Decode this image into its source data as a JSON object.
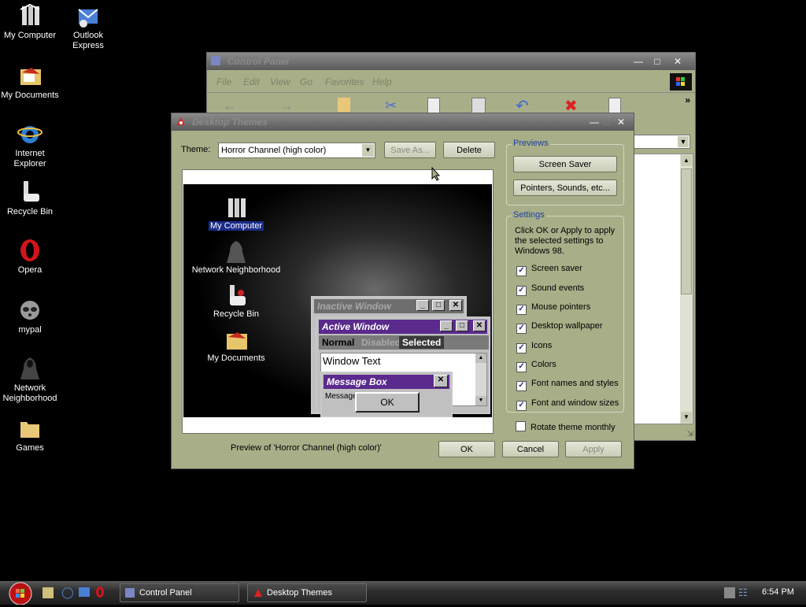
{
  "desktop": {
    "icons": [
      {
        "label": "My Computer",
        "icon": "computer-icon"
      },
      {
        "label": "Outlook Express",
        "icon": "outlook-icon"
      },
      {
        "label": "My Documents",
        "icon": "documents-icon"
      },
      {
        "label": "Internet Explorer",
        "icon": "ie-icon"
      },
      {
        "label": "Recycle Bin",
        "icon": "recycle-bin-icon"
      },
      {
        "label": "Opera",
        "icon": "opera-icon"
      },
      {
        "label": "mypal",
        "icon": "mypal-icon"
      },
      {
        "label": "Network Neighborhood",
        "icon": "network-icon"
      },
      {
        "label": "Games",
        "icon": "folder-icon"
      }
    ]
  },
  "control_panel": {
    "title": "Control Panel",
    "menu": [
      "File",
      "Edit",
      "View",
      "Go",
      "Favorites",
      "Help"
    ]
  },
  "dialog": {
    "title": "Desktop Themes",
    "theme_label": "Theme:",
    "theme_value": "Horror Channel (high color)",
    "save_as": "Save As...",
    "delete": "Delete",
    "previews_label": "Previews",
    "screen_saver_btn": "Screen Saver",
    "pointers_btn": "Pointers, Sounds, etc...",
    "settings_label": "Settings",
    "settings_desc": "Click OK or Apply to apply the selected settings to Windows 98.",
    "settings": [
      {
        "label": "Screen saver",
        "checked": true
      },
      {
        "label": "Sound events",
        "checked": true
      },
      {
        "label": "Mouse pointers",
        "checked": true
      },
      {
        "label": "Desktop wallpaper",
        "checked": true
      },
      {
        "label": "Icons",
        "checked": true
      },
      {
        "label": "Colors",
        "checked": true
      },
      {
        "label": "Font names and styles",
        "checked": true
      },
      {
        "label": "Font and window sizes",
        "checked": true
      }
    ],
    "rotate": "Rotate theme monthly",
    "preview_caption": "Preview of 'Horror Channel (high color)'",
    "ok": "OK",
    "cancel": "Cancel",
    "apply": "Apply",
    "preview": {
      "icons": [
        "My Computer",
        "Network Neighborhood",
        "Recycle Bin",
        "My Documents"
      ],
      "inactive_title": "Inactive Window",
      "active_title": "Active Window",
      "menu_normal": "Normal",
      "menu_disabled": "Disabled",
      "menu_selected": "Selected",
      "window_text": "Window Text",
      "msgbox_title": "Message Box",
      "msgbox_text": "Message Text",
      "msgbox_ok": "OK"
    }
  },
  "taskbar": {
    "tasks": [
      "Control Panel",
      "Desktop Themes"
    ],
    "clock": "6:54 PM"
  },
  "colors": {
    "dialog_bg": "#a8ae88",
    "active_title": "#5a2a8c",
    "group_label": "#1c3fa8"
  }
}
